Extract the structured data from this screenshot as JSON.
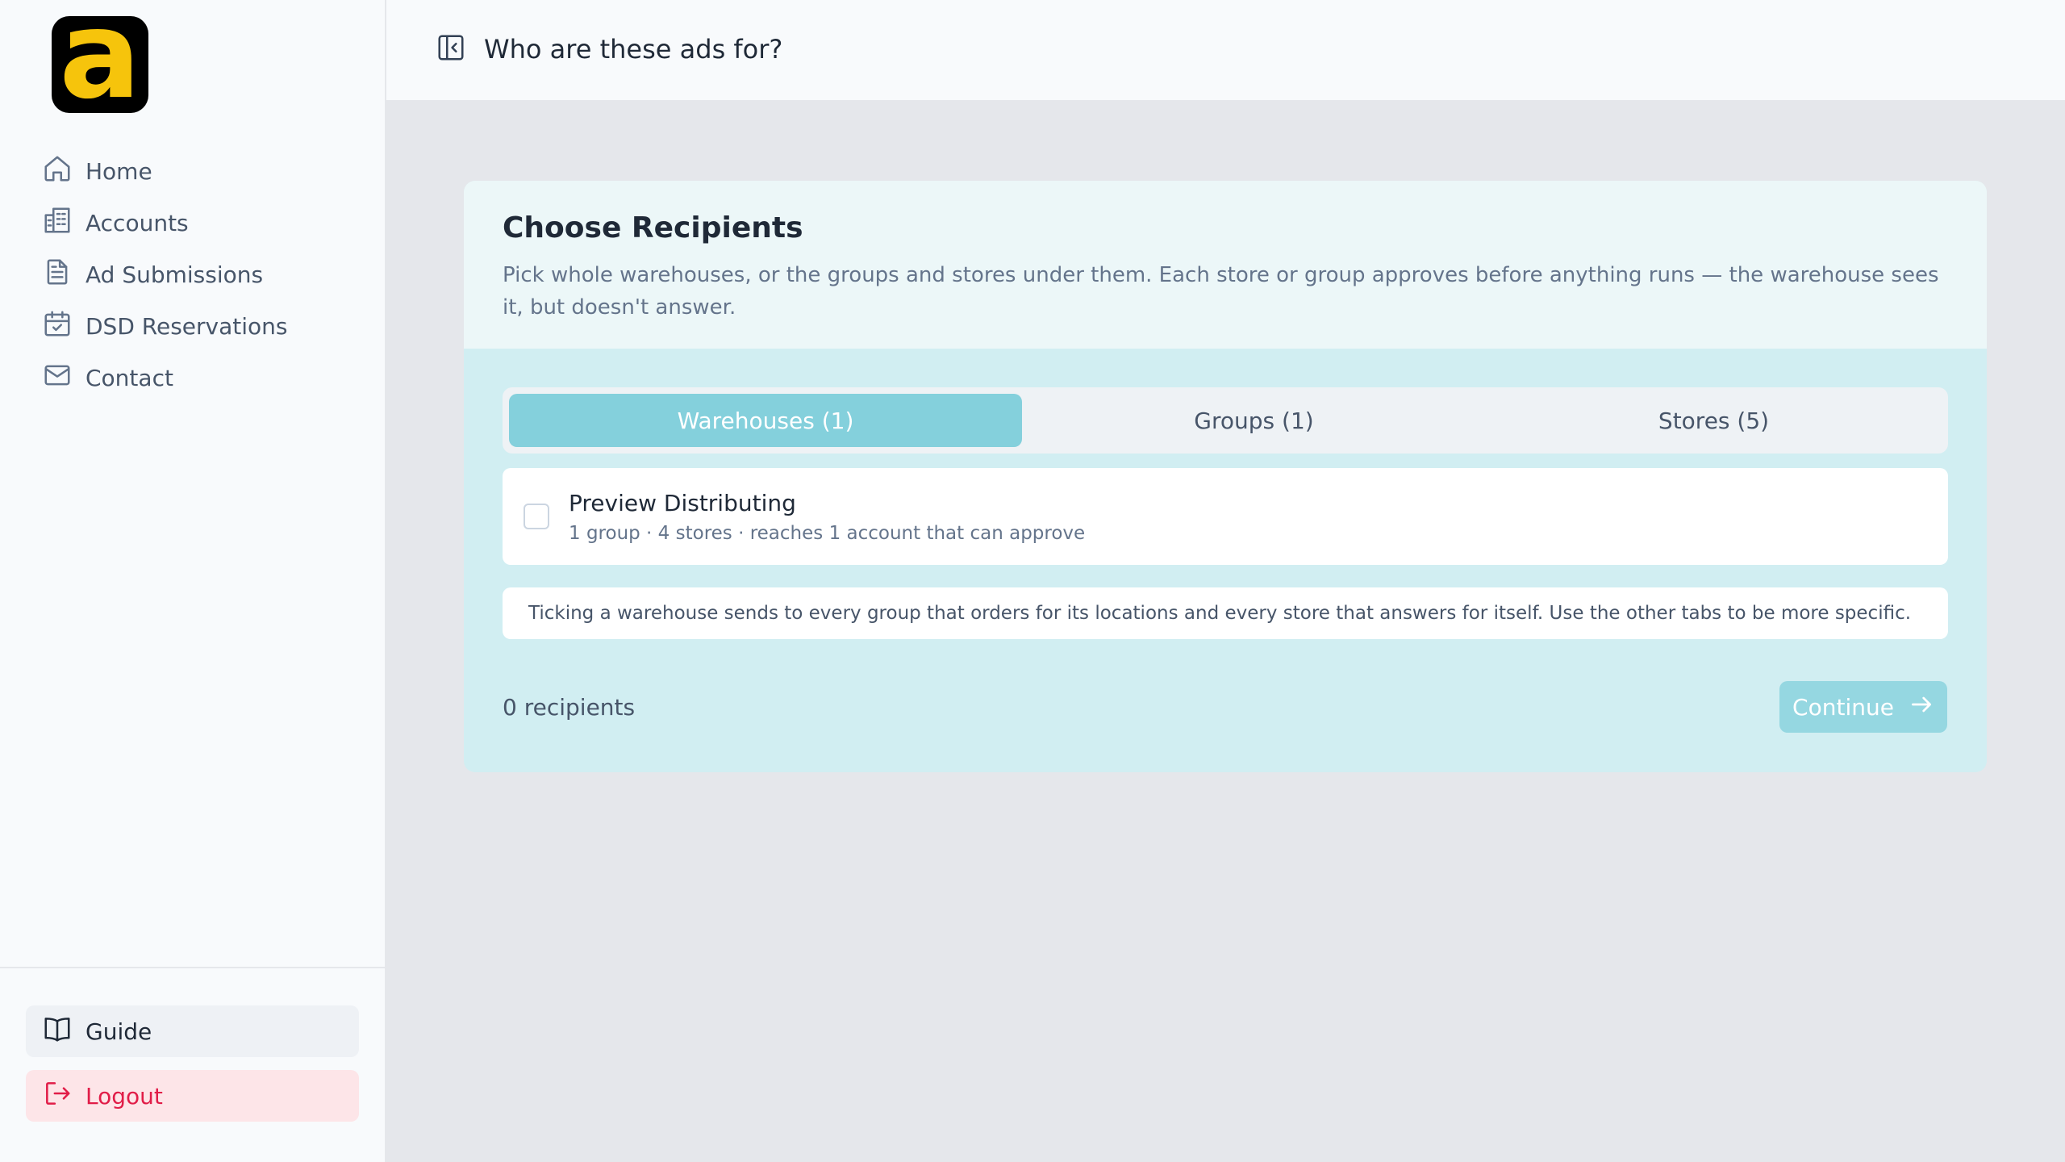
{
  "app": {
    "logo_letter": "a",
    "colors": {
      "brand_yellow": "#f6c40c",
      "accent": "#84d0dc",
      "logout": "#e11d48"
    }
  },
  "sidebar": {
    "items": [
      {
        "label": "Home",
        "icon": "home-icon"
      },
      {
        "label": "Accounts",
        "icon": "building-icon"
      },
      {
        "label": "Ad Submissions",
        "icon": "document-icon"
      },
      {
        "label": "DSD Reservations",
        "icon": "calendar-check-icon"
      },
      {
        "label": "Contact",
        "icon": "mail-icon"
      }
    ],
    "guide_label": "Guide",
    "logout_label": "Logout"
  },
  "header": {
    "title": "Who are these ads for?"
  },
  "recipients": {
    "title": "Choose Recipients",
    "description": "Pick whole warehouses, or the groups and stores under them. Each store or group approves before anything runs — the warehouse sees it, but doesn't answer.",
    "tabs": [
      {
        "label": "Warehouses (1)",
        "active": true
      },
      {
        "label": "Groups (1)",
        "active": false
      },
      {
        "label": "Stores (5)",
        "active": false
      }
    ],
    "items": [
      {
        "name": "Preview Distributing",
        "meta": "1 group · 4 stores · reaches 1 account that can approve",
        "checked": false
      }
    ],
    "note": "Ticking a warehouse sends to every group that orders for its locations and every store that answers for itself. Use the other tabs to be more specific.",
    "count_label": "0 recipients",
    "continue_label": "Continue"
  }
}
